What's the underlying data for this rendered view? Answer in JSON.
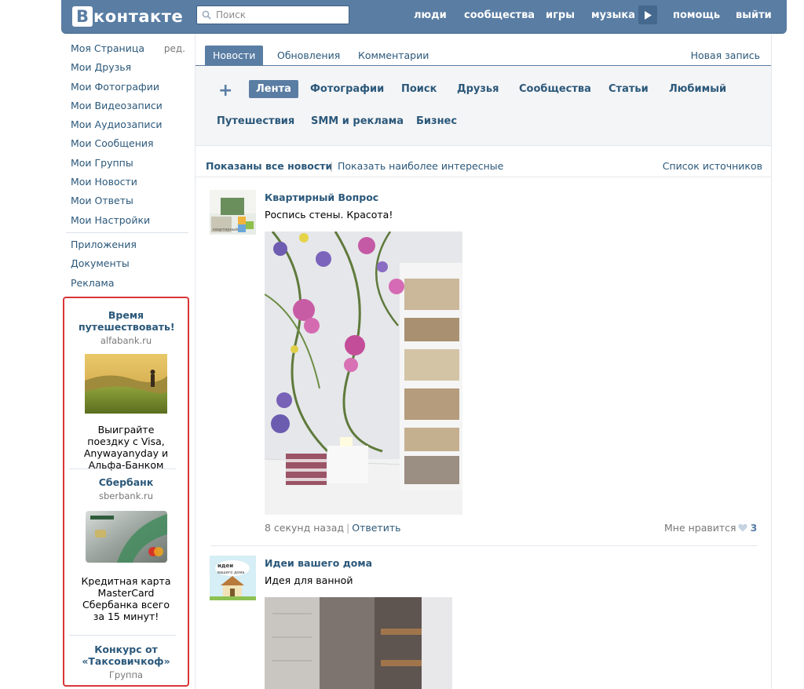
{
  "header": {
    "logo_letter": "В",
    "logo_text": "контакте",
    "search_placeholder": "Поиск",
    "nav": [
      "люди",
      "сообщества",
      "игры",
      "музыка",
      "помощь",
      "выйти"
    ]
  },
  "sidebar": {
    "items": [
      "Моя Страница",
      "Мои Друзья",
      "Мои Фотографии",
      "Мои Видеозаписи",
      "Мои Аудиозаписи",
      "Мои Сообщения",
      "Мои Группы",
      "Мои Новости",
      "Мои Ответы",
      "Мои Настройки"
    ],
    "edit_label": "ред.",
    "items2": [
      "Приложения",
      "Документы",
      "Реклама"
    ]
  },
  "ads": [
    {
      "title": "Время путешествовать!",
      "domain": "alfabank.ru",
      "desc": "Выиграйте поездку с Visa, Anywayanyday и Альфа-Банком"
    },
    {
      "title": "Сбербанк",
      "domain": "sberbank.ru",
      "desc": "Кредитная карта MasterCard Сбербанка всего за 15 минут!"
    },
    {
      "title": "Конкурс от «Таксовичкоф»",
      "domain": "Группа"
    }
  ],
  "tabs": {
    "items": [
      "Новости",
      "Обновления",
      "Комментарии"
    ],
    "new_post": "Новая запись"
  },
  "filters": {
    "row1": [
      "Лента",
      "Фотографии",
      "Поиск",
      "Друзья",
      "Сообщества",
      "Статьи",
      "Любимый"
    ],
    "row2": [
      "Путешествия",
      "SMM и реклама",
      "Бизнес"
    ]
  },
  "showbar": {
    "all": "Показаны все новости",
    "interesting": "Показать наиболее интересные",
    "sources": "Список источников"
  },
  "posts": [
    {
      "author": "Квартирный Вопрос",
      "text": "Роспись стены. Красота!",
      "time": "8 секунд назад",
      "reply": "Ответить",
      "like_label": "Мне нравится",
      "likes": "3"
    },
    {
      "author": "Идеи вашего дома",
      "text": "Идея для ванной"
    }
  ],
  "colors": {
    "header": "#597da3",
    "link": "#2b587a",
    "ad_border": "#d93538"
  }
}
